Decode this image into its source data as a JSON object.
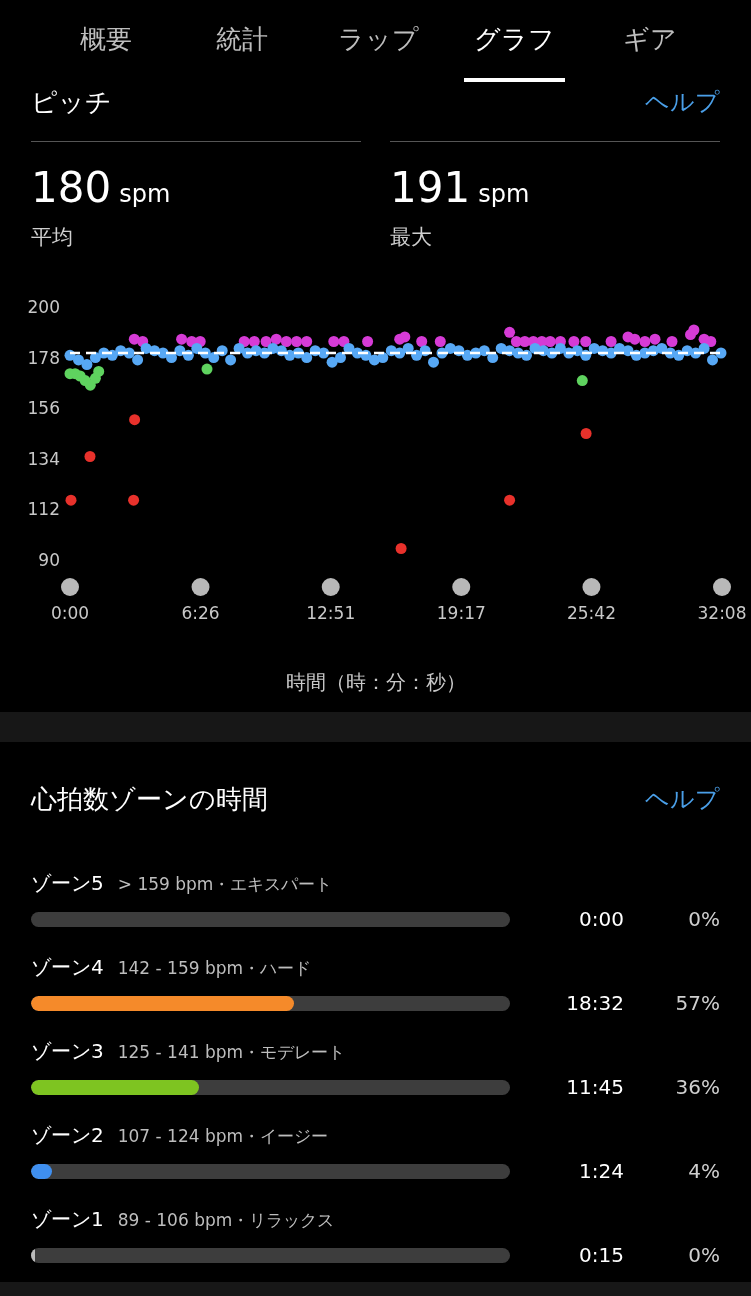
{
  "tabs": [
    {
      "label": "概要",
      "selected": false
    },
    {
      "label": "統計",
      "selected": false
    },
    {
      "label": "ラップ",
      "selected": false
    },
    {
      "label": "グラフ",
      "selected": true
    },
    {
      "label": "ギア",
      "selected": false
    }
  ],
  "cadence": {
    "title": "ピッチ",
    "help": "ヘルプ",
    "stats": [
      {
        "value": "180",
        "unit": "spm",
        "label": "平均"
      },
      {
        "value": "191",
        "unit": "spm",
        "label": "最大"
      }
    ],
    "chart_data": {
      "type": "scatter",
      "xlabel": "時間（時：分：秒）",
      "xlim": [
        0,
        1928
      ],
      "ylim": [
        90,
        200
      ],
      "ref_lines": [
        {
          "axis": "y",
          "value": 180
        }
      ],
      "yticks": [
        90,
        112,
        134,
        156,
        178,
        200
      ],
      "xticks": [
        {
          "value": 0,
          "label": "0:00"
        },
        {
          "value": 386,
          "label": "6:26"
        },
        {
          "value": 771,
          "label": "12:51"
        },
        {
          "value": 1157,
          "label": "19:17"
        },
        {
          "value": 1542,
          "label": "25:42"
        },
        {
          "value": 1928,
          "label": "32:08"
        }
      ],
      "series": [
        {
          "color": "#5fd35f",
          "x": [
            0,
            15,
            30,
            45,
            60,
            75,
            85,
            405,
            1515
          ],
          "values": [
            171,
            171,
            170,
            168,
            166,
            169,
            172,
            173,
            168
          ]
        },
        {
          "color": "#e8312b",
          "x": [
            3,
            59,
            188,
            191,
            979,
            1300,
            1526
          ],
          "values": [
            116,
            135,
            116,
            151,
            95,
            116,
            145
          ]
        },
        {
          "color": "#d63bd6",
          "x": [
            190,
            215,
            330,
            360,
            385,
            515,
            545,
            580,
            610,
            640,
            670,
            700,
            780,
            810,
            880,
            975,
            990,
            1040,
            1095,
            1300,
            1320,
            1345,
            1370,
            1395,
            1420,
            1450,
            1490,
            1525,
            1600,
            1650,
            1670,
            1700,
            1730,
            1780,
            1835,
            1845,
            1875,
            1895
          ],
          "values": [
            186,
            185,
            186,
            185,
            185,
            185,
            185,
            185,
            186,
            185,
            185,
            185,
            185,
            185,
            185,
            186,
            187,
            185,
            185,
            189,
            185,
            185,
            185,
            185,
            185,
            185,
            185,
            185,
            185,
            187,
            186,
            185,
            186,
            185,
            188,
            190,
            186,
            185
          ]
        },
        {
          "color": "#57a8f5",
          "x": [
            0,
            25,
            50,
            75,
            100,
            125,
            150,
            175,
            200,
            225,
            250,
            275,
            300,
            325,
            350,
            375,
            400,
            425,
            450,
            475,
            500,
            525,
            550,
            575,
            600,
            625,
            650,
            675,
            700,
            725,
            750,
            775,
            800,
            825,
            850,
            875,
            900,
            925,
            950,
            975,
            1000,
            1025,
            1050,
            1075,
            1100,
            1125,
            1150,
            1175,
            1200,
            1225,
            1250,
            1275,
            1300,
            1325,
            1350,
            1375,
            1400,
            1425,
            1450,
            1475,
            1500,
            1525,
            1550,
            1575,
            1600,
            1625,
            1650,
            1675,
            1700,
            1725,
            1750,
            1775,
            1800,
            1825,
            1850,
            1875,
            1900,
            1925
          ],
          "values": [
            179,
            177,
            175,
            178,
            180,
            179,
            181,
            180,
            177,
            182,
            181,
            180,
            178,
            181,
            179,
            182,
            180,
            178,
            181,
            177,
            182,
            180,
            181,
            180,
            182,
            181,
            179,
            180,
            178,
            181,
            180,
            176,
            178,
            182,
            180,
            179,
            177,
            178,
            181,
            180,
            182,
            179,
            181,
            176,
            180,
            182,
            181,
            179,
            180,
            181,
            178,
            182,
            181,
            180,
            179,
            182,
            181,
            180,
            182,
            180,
            181,
            179,
            182,
            181,
            180,
            182,
            181,
            179,
            180,
            181,
            182,
            180,
            179,
            181,
            180,
            182,
            177,
            180
          ]
        }
      ]
    }
  },
  "heart_rate_zones": {
    "title": "心拍数ゾーンの時間",
    "help": "ヘルプ",
    "zones": [
      {
        "name": "ゾーン5",
        "range": "> 159 bpm・エキスパート",
        "time": "0:00",
        "percent": "0%"
      },
      {
        "name": "ゾーン4",
        "range": "142 - 159 bpm・ハード",
        "time": "18:32",
        "percent": "57%",
        "level": 0.55,
        "color": "#f58a2a"
      },
      {
        "name": "ゾーン3",
        "range": "125 - 141 bpm・モデレート",
        "time": "11:45",
        "percent": "36%",
        "level": 0.35,
        "color": "#7ec421"
      },
      {
        "name": "ゾーン2",
        "range": "107 - 124 bpm・イージー",
        "time": "1:24",
        "percent": "4%",
        "level": 0.043,
        "color": "#3f8fef"
      },
      {
        "name": "ゾーン1",
        "range": "89 - 106 bpm・リラックス",
        "time": "0:15",
        "percent": "0%",
        "level": 0.008,
        "color": "#bbbbbb"
      }
    ]
  }
}
